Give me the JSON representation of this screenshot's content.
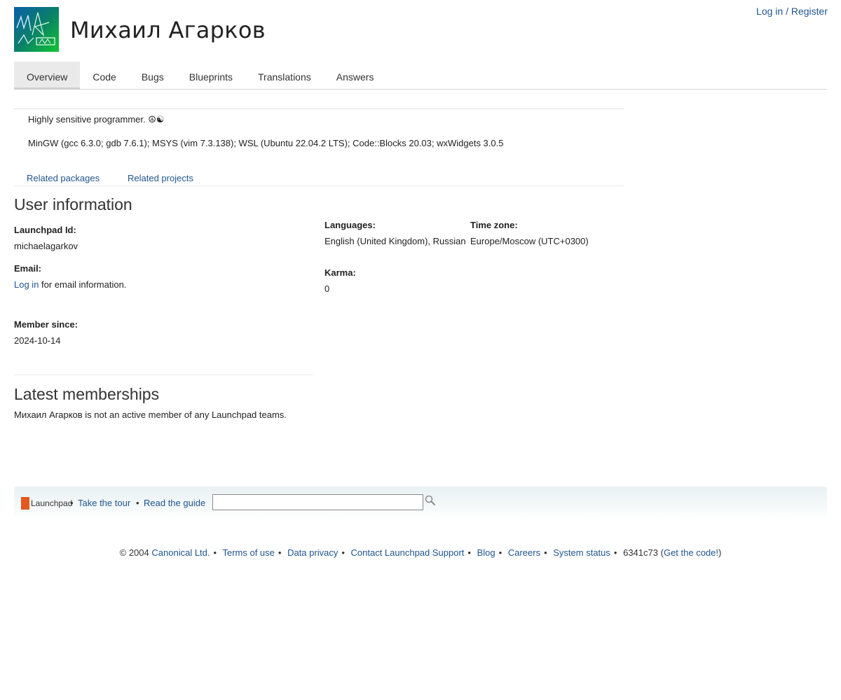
{
  "header": {
    "avatar_alt": "",
    "title": "Михаил Агарков",
    "login": "Log in / Register"
  },
  "tabs": [
    {
      "label": "Overview",
      "active": true
    },
    {
      "label": "Code",
      "active": false
    },
    {
      "label": "Bugs",
      "active": false
    },
    {
      "label": "Blueprints",
      "active": false
    },
    {
      "label": "Translations",
      "active": false
    },
    {
      "label": "Answers",
      "active": false
    }
  ],
  "description": {
    "line1": "Highly sensitive programmer. ☮☯",
    "line2": "MinGW (gcc 6.3.0; gdb 7.6.1); MSYS (vim 7.3.138); WSL (Ubuntu 22.04.2 LTS); Code::Blocks 20.03; wxWidgets 3.0.5"
  },
  "related": {
    "packages": "Related packages",
    "projects": "Related projects"
  },
  "user_info": {
    "heading": "User information",
    "launchpad_id_label": "Launchpad Id:",
    "launchpad_id": "michaelagarkov",
    "email_label": "Email:",
    "email_login_link": "Log in",
    "email_suffix": " for email information.",
    "member_since_label": "Member since:",
    "member_since": "2024-10-14",
    "languages_label": "Languages:",
    "languages": "English (United Kingdom), Russian",
    "timezone_label": "Time zone:",
    "timezone": "Europe/Moscow (UTC+0300)",
    "karma_label": "Karma:",
    "karma": "0"
  },
  "memberships": {
    "heading": "Latest memberships",
    "text": "Михаил Агарков is not an active member of any Launchpad teams."
  },
  "footer_band": {
    "logo_text": "Launchpad",
    "tour": "Take the tour",
    "guide": "Read the guide",
    "search_value": "",
    "bullet": "•"
  },
  "footer": {
    "copyright": "© 2004",
    "canonical": "Canonical Ltd.",
    "terms": "Terms of use",
    "privacy": "Data privacy",
    "contact": "Contact Launchpad Support",
    "blog": "Blog",
    "careers": "Careers",
    "status": "System status",
    "revision": "6341c73",
    "get_code": "Get the code!",
    "bullet": "•"
  },
  "colors": {
    "link": "#1f5591",
    "logo_orange": "#e2581f"
  }
}
